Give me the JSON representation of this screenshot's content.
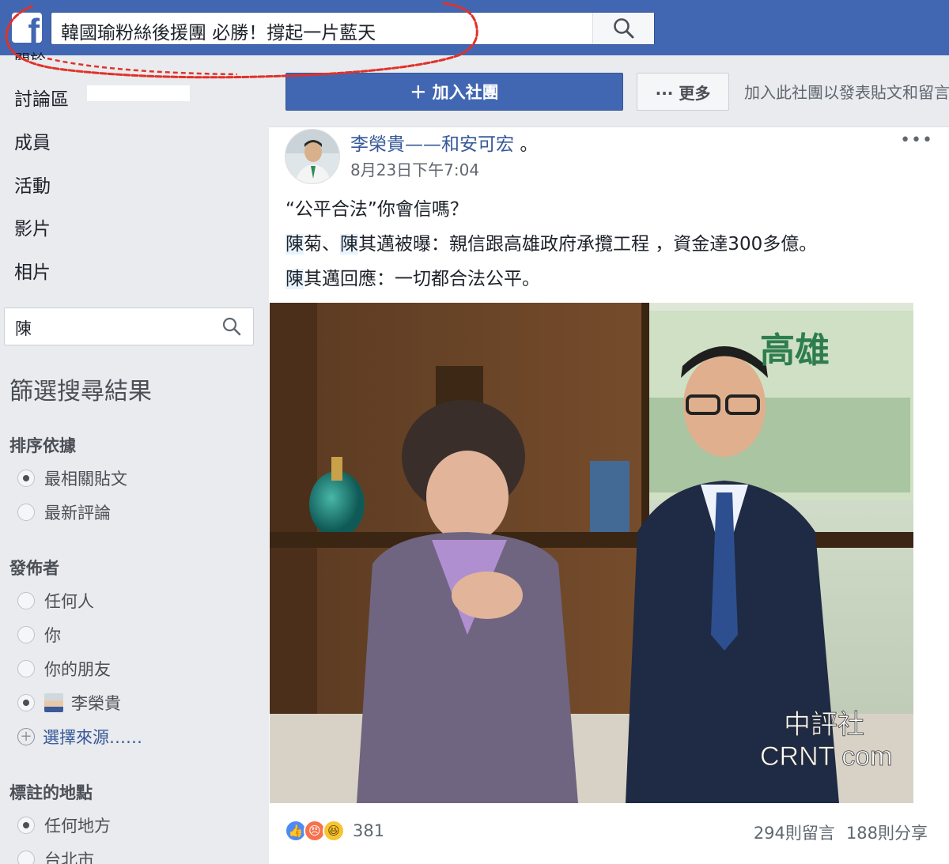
{
  "topbar": {
    "logo": "f",
    "search_value": "韓國瑜粉絲後援團 必勝！撐起一片藍天",
    "search_icon": "search-icon"
  },
  "sidebar": {
    "cut_item": "關於",
    "nav": [
      "討論區",
      "成員",
      "活動",
      "影片",
      "相片"
    ],
    "search_value": "陳",
    "filter_title": "篩選搜尋結果",
    "sort_heading": "排序依據",
    "sort_options": [
      "最相關貼文",
      "最新評論"
    ],
    "poster_heading": "發佈者",
    "poster_options": [
      "任何人",
      "你",
      "你的朋友",
      "李榮貴"
    ],
    "choose_source": "選擇來源……",
    "place_heading": "標註的地點",
    "place_options": [
      "任何地方",
      "台北市"
    ]
  },
  "group": {
    "join_label": "＋ 加入社團",
    "more_label": "··· 更多",
    "join_hint": "加入此社團以發表貼文和留言"
  },
  "post": {
    "author_name": "李榮貴——和安可宏",
    "author_suffix": "。",
    "time": "8月23日下午7:04",
    "menu": "•••",
    "line1": "“公平合法”你會信嗎？",
    "line2_a": "陳",
    "line2_b": "菊、",
    "line2_c": "陳",
    "line2_d": "其邁被曝：親信跟高雄政府承攬工程 ，資金達300多億。",
    "line3_a": "陳",
    "line3_b": "其邁回應：一切都合法公平。",
    "photo_sign": "高雄",
    "photo_watermark_top": "中評社",
    "photo_watermark_bottom": "CRNT  com",
    "reaction_count": "381",
    "comments": "294則留言",
    "shares": "188則分享"
  },
  "colors": {
    "brand": "#4267b2",
    "link": "#365899",
    "scribble": "#e0322a"
  }
}
